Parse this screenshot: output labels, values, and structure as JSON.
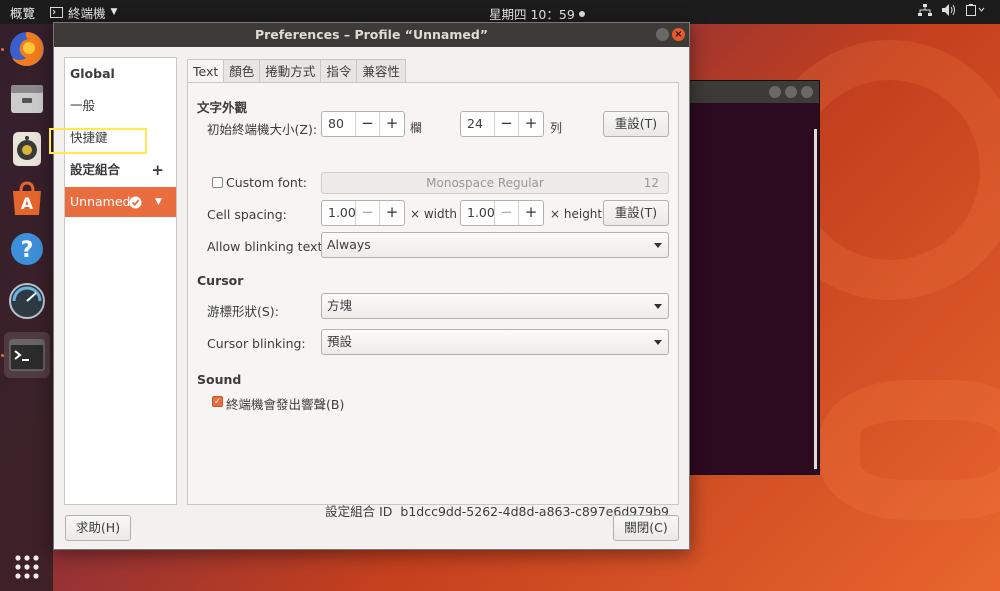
{
  "topbar": {
    "activities": "概覽",
    "app_menu": "終端機",
    "clock": "星期四 10：59"
  },
  "dock": {
    "items": [
      "firefox-icon",
      "files-icon",
      "rhythmbox-icon",
      "software-center-icon",
      "help-icon",
      "system-monitor-icon",
      "terminal-icon",
      "show-apps-icon"
    ]
  },
  "dialog": {
    "title": "Preferences – Profile “Unnamed”",
    "sidebar": {
      "global_header": "Global",
      "general": "一般",
      "shortcuts": "快捷鍵",
      "profiles_header": "設定組合",
      "add": "+",
      "profile_name": "Unnamed"
    },
    "tabs": [
      "Text",
      "顏色",
      "捲動方式",
      "指令",
      "兼容性"
    ],
    "text_tab": {
      "appearance_header": "文字外觀",
      "initial_size_label": "初始終端機大小(Z):",
      "columns_value": "80",
      "columns_unit": "欄",
      "rows_value": "24",
      "rows_unit": "列",
      "reset_label": "重設(T)",
      "custom_font_label": "Custom font:",
      "custom_font_checked": false,
      "font_name": "Monospace Regular",
      "font_size": "12",
      "cell_spacing_label": "Cell spacing:",
      "width_value": "1.00",
      "width_unit": "× width",
      "height_value": "1.00",
      "height_unit": "× height",
      "reset2_label": "重設(T)",
      "blink_text_label": "Allow blinking text:",
      "blink_text_value": "Always",
      "cursor_header": "Cursor",
      "cursor_shape_label": "游標形狀(S):",
      "cursor_shape_value": "方塊",
      "cursor_blink_label": "Cursor blinking:",
      "cursor_blink_value": "預設",
      "sound_header": "Sound",
      "bell_label": "終端機會發出響聲(B)",
      "bell_checked": true,
      "profile_id_label": "設定組合 ID",
      "profile_id": "b1dcc9dd-5262-4d8d-a863-c897e6d979b9"
    },
    "help_button": "求助(H)",
    "close_button": "關閉(C)"
  },
  "colors": {
    "accent": "#e96d3e",
    "titlebar": "#3c3b37",
    "topbar": "#1c1c1c"
  }
}
